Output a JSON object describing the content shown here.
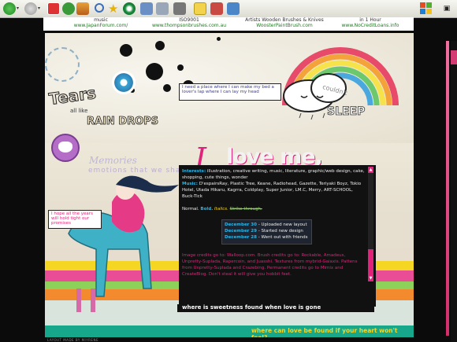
{
  "toolbar": {
    "buttons": [
      "back-icon",
      "forward-icon",
      "stop-icon",
      "refresh-icon",
      "home-icon",
      "search-icon",
      "favorites-icon",
      "media-icon",
      "history-icon",
      "mail-icon",
      "print-icon",
      "edit-icon",
      "discuss-icon",
      "messenger-icon"
    ]
  },
  "ads": [
    {
      "title": "music",
      "url": "www.JapanForum.com/"
    },
    {
      "title": "ISO9001",
      "url": "www.thompsonbrushes.com.au"
    },
    {
      "title": "Artists Wooden Brushes & Knives",
      "url": "WoosterPaintBrush.com"
    },
    {
      "title": "in 1 Hour",
      "url": "www.NoCreditLoans.info"
    }
  ],
  "decor": {
    "tears": "Tears",
    "all_like": "all like",
    "rain_drops": "RAIN DROPS",
    "sleep": "SLEEP",
    "couldnt": "couldn't",
    "memories": "Memories",
    "emotions": "emotions that we shared"
  },
  "speech_top": "I need a place where I can make my bed a lover's lap where I can lay my head",
  "speech_left": "I hope all the years will hold tight our promises",
  "title": {
    "script": "I",
    "main": "love me,"
  },
  "profile": {
    "interests_label": "Interests:",
    "interests_text": "illustration, creative writing, music, literature, graphic/web design, cake, shopping, cute things, wonder",
    "music_label": "Music:",
    "music_text": "D'espairsRay, Plastic Tree, Keane, Radiohead, Gazette, Teriyaki Boyz, Tokio Hotel, Utada Hikaru, Kagrra, Coldplay, Super Junior, LM.C, Merry, ART-SCHOOL, Buck-Tick",
    "styles": [
      "Normal.",
      "Bold.",
      "Italics.",
      "Strike-through."
    ]
  },
  "updates": [
    {
      "date": "December 30",
      "text": "- Uploaded new layout"
    },
    {
      "date": "December 29",
      "text": "- Started new design"
    },
    {
      "date": "December 28",
      "text": "- Went out with friends"
    }
  ],
  "credits": "Image credits go to: Walloop.com. Brush credits go to: Rockable, Amadeus, Unpretty-Suplada, Rapercoin, and Juasshi. Textures from mybrid-Gaiaxis. Pattens from Unpretty-Suplada and Crazebing. Permanent credits go to Mimix and CreateBlog. Don't steal it will give you hobbit feet.",
  "quote_black": "where is sweetness found when love is gone",
  "quote_bottom": "where can love be found if your heart won't feel?",
  "footer": "LAYOUT MADE BY MIYRENE",
  "colors": {
    "accent_pink": "#e0227a",
    "accent_blue": "#2bb5e6",
    "banner_green": "#17a88c"
  }
}
